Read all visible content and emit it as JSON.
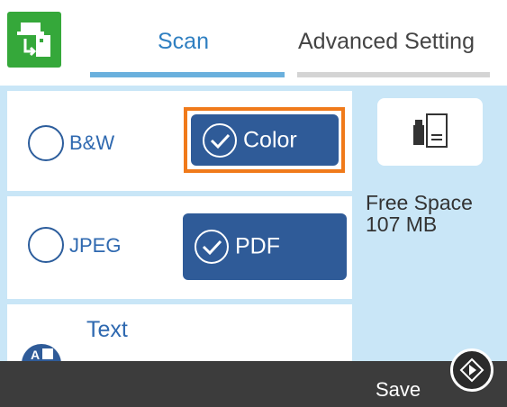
{
  "tabs": [
    {
      "label": "Scan",
      "active": true
    },
    {
      "label": "Advanced Setting"
    }
  ],
  "color_mode": {
    "options": [
      {
        "label": "B&W",
        "selected": false
      },
      {
        "label": "Color",
        "selected": true
      }
    ]
  },
  "file_format": {
    "options": [
      {
        "label": "JPEG",
        "selected": false
      },
      {
        "label": "PDF",
        "selected": true
      }
    ]
  },
  "third_row": {
    "label": "Text"
  },
  "storage": {
    "free_space_label": "Free Space",
    "free_space_value": "107 MB"
  },
  "footer": {
    "save_label": "Save"
  },
  "colors": {
    "accent_blue": "#2f7fc1",
    "selected_button": "#2f5b98",
    "focus_orange": "#f07a1a",
    "panel_bg": "#c9e6f7",
    "app_icon_green": "#35a83a"
  }
}
